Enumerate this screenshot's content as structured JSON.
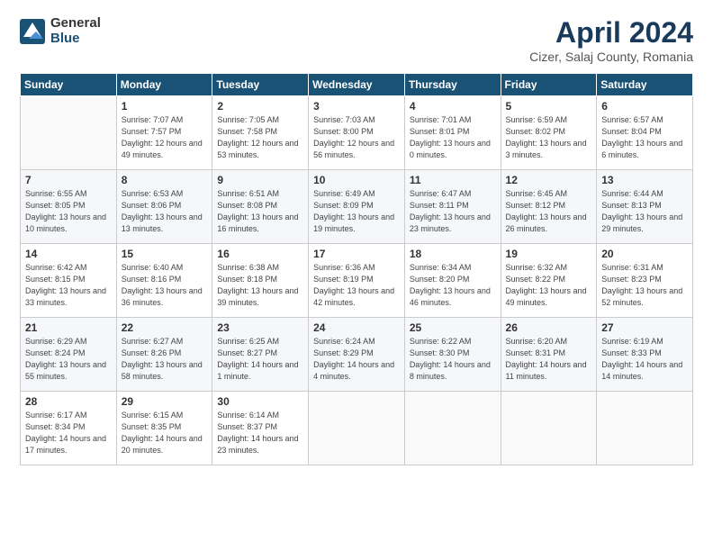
{
  "logo": {
    "general": "General",
    "blue": "Blue"
  },
  "header": {
    "month_year": "April 2024",
    "location": "Cizer, Salaj County, Romania"
  },
  "weekdays": [
    "Sunday",
    "Monday",
    "Tuesday",
    "Wednesday",
    "Thursday",
    "Friday",
    "Saturday"
  ],
  "weeks": [
    [
      {
        "day": "",
        "sunrise": "",
        "sunset": "",
        "daylight": ""
      },
      {
        "day": "1",
        "sunrise": "Sunrise: 7:07 AM",
        "sunset": "Sunset: 7:57 PM",
        "daylight": "Daylight: 12 hours and 49 minutes."
      },
      {
        "day": "2",
        "sunrise": "Sunrise: 7:05 AM",
        "sunset": "Sunset: 7:58 PM",
        "daylight": "Daylight: 12 hours and 53 minutes."
      },
      {
        "day": "3",
        "sunrise": "Sunrise: 7:03 AM",
        "sunset": "Sunset: 8:00 PM",
        "daylight": "Daylight: 12 hours and 56 minutes."
      },
      {
        "day": "4",
        "sunrise": "Sunrise: 7:01 AM",
        "sunset": "Sunset: 8:01 PM",
        "daylight": "Daylight: 13 hours and 0 minutes."
      },
      {
        "day": "5",
        "sunrise": "Sunrise: 6:59 AM",
        "sunset": "Sunset: 8:02 PM",
        "daylight": "Daylight: 13 hours and 3 minutes."
      },
      {
        "day": "6",
        "sunrise": "Sunrise: 6:57 AM",
        "sunset": "Sunset: 8:04 PM",
        "daylight": "Daylight: 13 hours and 6 minutes."
      }
    ],
    [
      {
        "day": "7",
        "sunrise": "Sunrise: 6:55 AM",
        "sunset": "Sunset: 8:05 PM",
        "daylight": "Daylight: 13 hours and 10 minutes."
      },
      {
        "day": "8",
        "sunrise": "Sunrise: 6:53 AM",
        "sunset": "Sunset: 8:06 PM",
        "daylight": "Daylight: 13 hours and 13 minutes."
      },
      {
        "day": "9",
        "sunrise": "Sunrise: 6:51 AM",
        "sunset": "Sunset: 8:08 PM",
        "daylight": "Daylight: 13 hours and 16 minutes."
      },
      {
        "day": "10",
        "sunrise": "Sunrise: 6:49 AM",
        "sunset": "Sunset: 8:09 PM",
        "daylight": "Daylight: 13 hours and 19 minutes."
      },
      {
        "day": "11",
        "sunrise": "Sunrise: 6:47 AM",
        "sunset": "Sunset: 8:11 PM",
        "daylight": "Daylight: 13 hours and 23 minutes."
      },
      {
        "day": "12",
        "sunrise": "Sunrise: 6:45 AM",
        "sunset": "Sunset: 8:12 PM",
        "daylight": "Daylight: 13 hours and 26 minutes."
      },
      {
        "day": "13",
        "sunrise": "Sunrise: 6:44 AM",
        "sunset": "Sunset: 8:13 PM",
        "daylight": "Daylight: 13 hours and 29 minutes."
      }
    ],
    [
      {
        "day": "14",
        "sunrise": "Sunrise: 6:42 AM",
        "sunset": "Sunset: 8:15 PM",
        "daylight": "Daylight: 13 hours and 33 minutes."
      },
      {
        "day": "15",
        "sunrise": "Sunrise: 6:40 AM",
        "sunset": "Sunset: 8:16 PM",
        "daylight": "Daylight: 13 hours and 36 minutes."
      },
      {
        "day": "16",
        "sunrise": "Sunrise: 6:38 AM",
        "sunset": "Sunset: 8:18 PM",
        "daylight": "Daylight: 13 hours and 39 minutes."
      },
      {
        "day": "17",
        "sunrise": "Sunrise: 6:36 AM",
        "sunset": "Sunset: 8:19 PM",
        "daylight": "Daylight: 13 hours and 42 minutes."
      },
      {
        "day": "18",
        "sunrise": "Sunrise: 6:34 AM",
        "sunset": "Sunset: 8:20 PM",
        "daylight": "Daylight: 13 hours and 46 minutes."
      },
      {
        "day": "19",
        "sunrise": "Sunrise: 6:32 AM",
        "sunset": "Sunset: 8:22 PM",
        "daylight": "Daylight: 13 hours and 49 minutes."
      },
      {
        "day": "20",
        "sunrise": "Sunrise: 6:31 AM",
        "sunset": "Sunset: 8:23 PM",
        "daylight": "Daylight: 13 hours and 52 minutes."
      }
    ],
    [
      {
        "day": "21",
        "sunrise": "Sunrise: 6:29 AM",
        "sunset": "Sunset: 8:24 PM",
        "daylight": "Daylight: 13 hours and 55 minutes."
      },
      {
        "day": "22",
        "sunrise": "Sunrise: 6:27 AM",
        "sunset": "Sunset: 8:26 PM",
        "daylight": "Daylight: 13 hours and 58 minutes."
      },
      {
        "day": "23",
        "sunrise": "Sunrise: 6:25 AM",
        "sunset": "Sunset: 8:27 PM",
        "daylight": "Daylight: 14 hours and 1 minute."
      },
      {
        "day": "24",
        "sunrise": "Sunrise: 6:24 AM",
        "sunset": "Sunset: 8:29 PM",
        "daylight": "Daylight: 14 hours and 4 minutes."
      },
      {
        "day": "25",
        "sunrise": "Sunrise: 6:22 AM",
        "sunset": "Sunset: 8:30 PM",
        "daylight": "Daylight: 14 hours and 8 minutes."
      },
      {
        "day": "26",
        "sunrise": "Sunrise: 6:20 AM",
        "sunset": "Sunset: 8:31 PM",
        "daylight": "Daylight: 14 hours and 11 minutes."
      },
      {
        "day": "27",
        "sunrise": "Sunrise: 6:19 AM",
        "sunset": "Sunset: 8:33 PM",
        "daylight": "Daylight: 14 hours and 14 minutes."
      }
    ],
    [
      {
        "day": "28",
        "sunrise": "Sunrise: 6:17 AM",
        "sunset": "Sunset: 8:34 PM",
        "daylight": "Daylight: 14 hours and 17 minutes."
      },
      {
        "day": "29",
        "sunrise": "Sunrise: 6:15 AM",
        "sunset": "Sunset: 8:35 PM",
        "daylight": "Daylight: 14 hours and 20 minutes."
      },
      {
        "day": "30",
        "sunrise": "Sunrise: 6:14 AM",
        "sunset": "Sunset: 8:37 PM",
        "daylight": "Daylight: 14 hours and 23 minutes."
      },
      {
        "day": "",
        "sunrise": "",
        "sunset": "",
        "daylight": ""
      },
      {
        "day": "",
        "sunrise": "",
        "sunset": "",
        "daylight": ""
      },
      {
        "day": "",
        "sunrise": "",
        "sunset": "",
        "daylight": ""
      },
      {
        "day": "",
        "sunrise": "",
        "sunset": "",
        "daylight": ""
      }
    ]
  ]
}
